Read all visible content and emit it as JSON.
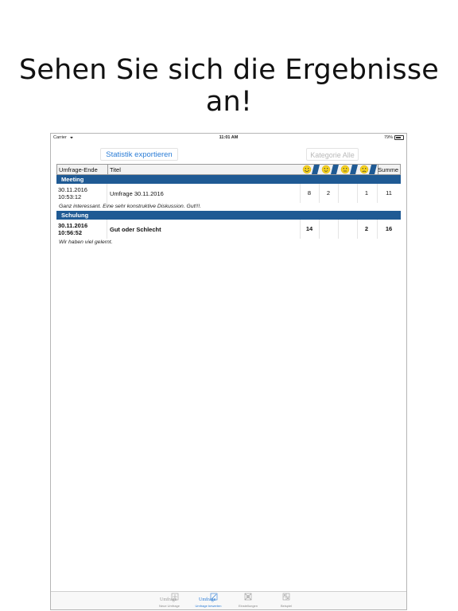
{
  "headline": "Sehen Sie sich die Ergebnisse an!",
  "statusbar": {
    "carrier": "Carrier",
    "time": "11:01 AM",
    "battery": "79%"
  },
  "toolbar": {
    "export_label": "Statistik exportieren",
    "category_label": "Kategorie Alle"
  },
  "table": {
    "headers": {
      "end": "Umfrage-Ende",
      "title": "Titel",
      "sum": "Summe"
    },
    "groups": [
      {
        "name": "Meeting",
        "rows": [
          {
            "date": "30.11.2016",
            "time": "10:53:12",
            "title": "Umfrage 30.11.2016",
            "v1": "8",
            "v2": "2",
            "v3": "",
            "v4": "1",
            "sum": "11",
            "comment": "Ganz interessant. Eine sehr konstruktive Diskussion. Gut!!!."
          }
        ]
      },
      {
        "name": "Schulung",
        "rows": [
          {
            "date": "30.11.2016",
            "time": "10:56:52",
            "title": "Gut oder Schlecht",
            "v1": "14",
            "v2": "",
            "v3": "",
            "v4": "2",
            "sum": "16",
            "comment": "Wir haben viel gelernt."
          }
        ]
      }
    ]
  },
  "tabbar": {
    "tabs": [
      {
        "label": "Neue Umfrage",
        "icon_text": "Umfrage"
      },
      {
        "label": "Umfrage bewerten",
        "icon_text": "Umfrage"
      },
      {
        "label": "Einstellungen",
        "icon_text": ""
      },
      {
        "label": "Beispiel",
        "icon_text": ""
      }
    ]
  },
  "colors": {
    "accent": "#2a7cd6",
    "group_bar": "#1f5a94",
    "smiley": "#f5d21f"
  }
}
